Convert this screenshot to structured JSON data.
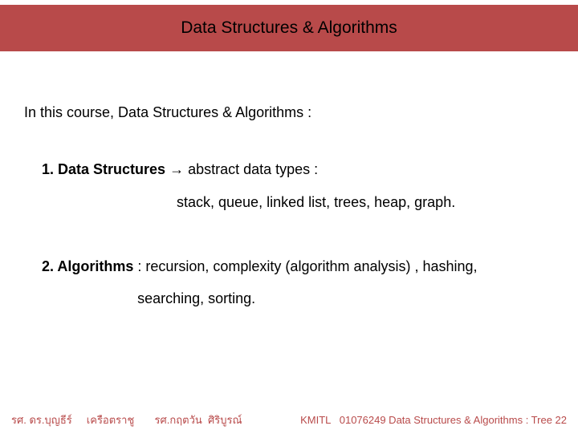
{
  "title": "Data Structures & Algorithms",
  "intro": "In this course, Data Structures & Algorithms :",
  "item1_num": "1. ",
  "item1_bold": "Data Structures ",
  "item1_arrow": "→",
  "item1_rest": " abstract data types :",
  "item1_sub": "stack, queue, linked list, trees, heap, graph.",
  "item2_num": "2. ",
  "item2_bold": "Algorithms",
  "item2_rest1": " : recursion, complexity (algorithm analysis) , hashing,",
  "item2_rest2": "searching, sorting.",
  "footer_left": "รศ. ดร.บุญธีร์     เครือตราชู       รศ.กฤตวัน  ศิริบูรณ์",
  "footer_right": "KMITL   01076249 Data Structures & Algorithms : Tree 22"
}
